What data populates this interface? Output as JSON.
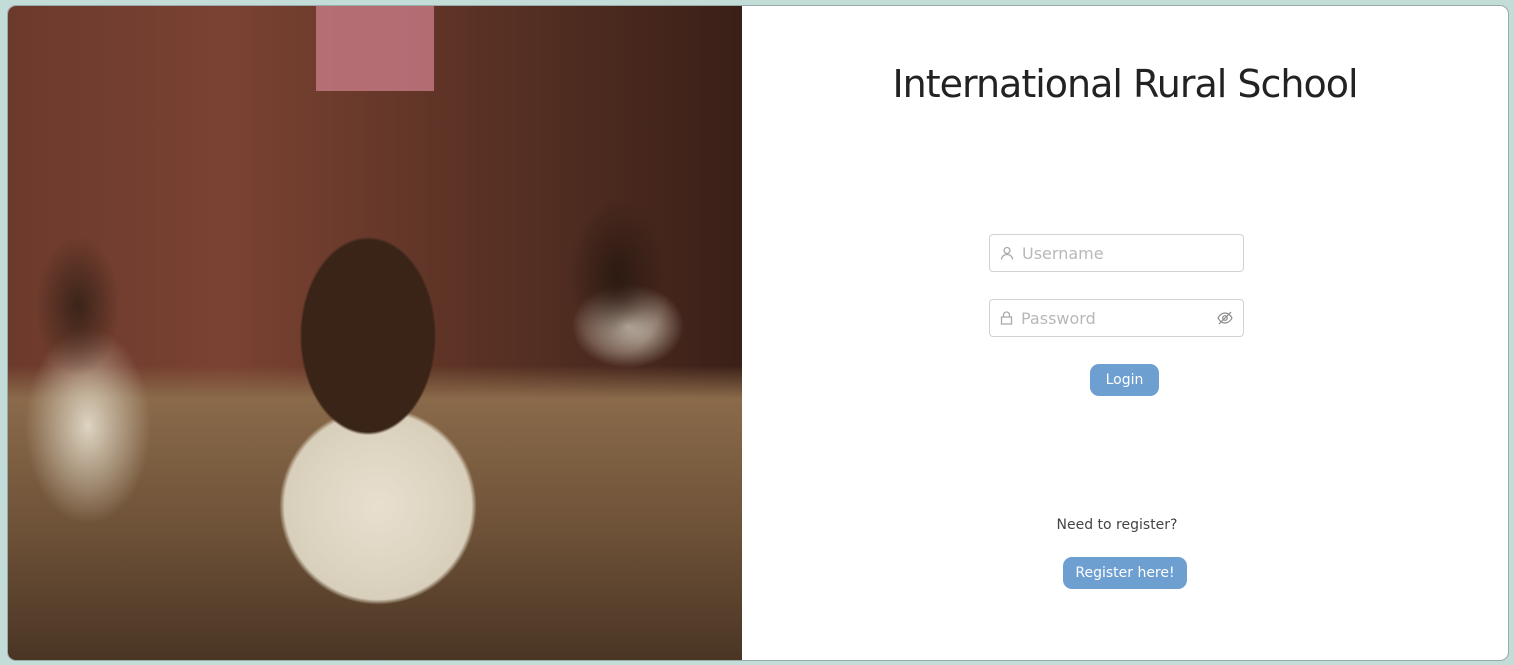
{
  "title": "International Rural School",
  "login_form": {
    "username_placeholder": "Username",
    "password_placeholder": "Password",
    "login_label": "Login"
  },
  "register": {
    "prompt": "Need to register?",
    "button_label": "Register here!"
  },
  "colors": {
    "accent": "#6d9fd0",
    "background": "#c4dcd7"
  }
}
